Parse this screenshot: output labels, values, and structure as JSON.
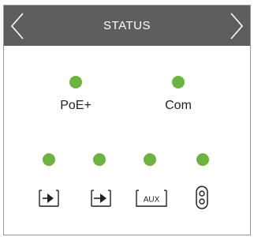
{
  "header": {
    "title": "STATUS",
    "prev_icon": "chevron-left-icon",
    "next_icon": "chevron-right-icon",
    "background": "#5e5e5e"
  },
  "indicators": {
    "led_color": "#6cb33f",
    "top": [
      {
        "label": "PoE+",
        "state": "on"
      },
      {
        "label": "Com",
        "state": "on"
      }
    ],
    "bottom": [
      {
        "icon": "input-arrow-icon",
        "state": "on"
      },
      {
        "icon": "output-arrow-icon",
        "state": "on"
      },
      {
        "icon": "aux-port-icon",
        "label": "AUX",
        "state": "on"
      },
      {
        "icon": "connector-port-icon",
        "state": "on"
      }
    ]
  }
}
